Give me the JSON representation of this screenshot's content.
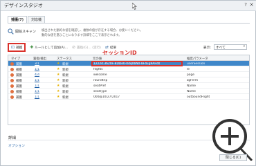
{
  "window": {
    "title": "デザインスタジオ",
    "help_label": "?",
    "close_label": "×"
  },
  "tabs": [
    {
      "label": "捕獲(7)",
      "active": true
    },
    {
      "label": "対応機",
      "active": false
    }
  ],
  "scan": {
    "button_label": "開始スキャン",
    "hint_line1": "検出された動的な値を確認し、複数の値が存在する場合、お使いください。",
    "hint_line2": "動的な値を選ぶことになります詳細をここで表示されます。"
  },
  "toolbar": {
    "capture_label": "捕獲",
    "add_rule_label": "ルールとして追加(A)...",
    "exclude_label": "置換(G)... (実行)",
    "result_label": "結果",
    "display_label": "表示:",
    "display_value": "すべて"
  },
  "annotation": {
    "text": "セッションID"
  },
  "table": {
    "columns": [
      "タイプ",
      "置換/検出",
      "ステータス",
      "元の値",
      "",
      "",
      "",
      "推奨パラメータ"
    ],
    "rows": [
      {
        "type": "捕獲",
        "replace": "3/1",
        "status": "新規",
        "value": "12224.3620F-8DDe0-0dq0bN0-8F4Eg9AFd0",
        "param": "userSession",
        "selected": true,
        "dot_color": "#e07040"
      },
      {
        "type": "捕獲",
        "replace": "1/1",
        "status": "新規",
        "value": "flights",
        "param": "le",
        "selected": false,
        "dot_color": "#e07040"
      },
      {
        "type": "捕獲",
        "replace": "4/4",
        "status": "新規",
        "value": "welcome",
        "param": "page",
        "selected": false,
        "dot_color": "#e07040"
      },
      {
        "type": "捕獲",
        "replace": "1/1",
        "status": "新規",
        "value": "roundtrip",
        "param": "zgFerm",
        "selected": false,
        "dot_color": "#e07040"
      },
      {
        "type": "捕獲",
        "replace": "1/1",
        "status": "新規",
        "value": "seatPref",
        "param": "Name",
        "selected": false,
        "dot_color": "#e07040"
      },
      {
        "type": "捕獲",
        "replace": "1/1",
        "status": "新規",
        "value": "seatType",
        "param": "Name",
        "selected": false,
        "dot_color": "#e07040"
      },
      {
        "type": "捕獲",
        "replace": "1/1",
        "status": "新規",
        "value": "000@10/27/2017",
        "param": "outboundFlight",
        "selected": false,
        "dot_color": "#e07040"
      }
    ]
  },
  "details": {
    "label": "詳細",
    "option_label": "オプション"
  },
  "footer": {
    "close_button_label": "閉じる(C)"
  },
  "colors": {
    "accent": "#3f87c9",
    "highlight": "#d9312b",
    "link": "#1f5fa8"
  }
}
